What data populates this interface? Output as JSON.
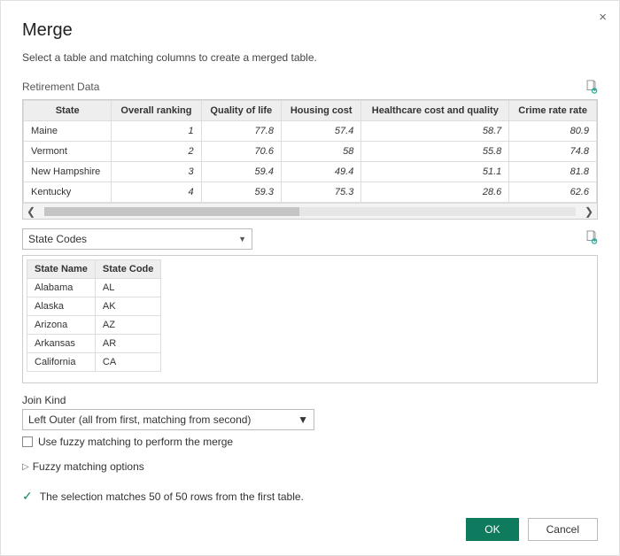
{
  "dialog": {
    "title": "Merge",
    "subtitle": "Select a table and matching columns to create a merged table.",
    "close_label": "×"
  },
  "table1": {
    "label": "Retirement Data",
    "columns": [
      "State",
      "Overall ranking",
      "Quality of life",
      "Housing cost",
      "Healthcare cost and quality",
      "Crime rate rate"
    ],
    "rows": [
      {
        "state": "Maine",
        "rank": "1",
        "quality": "77.8",
        "housing": "57.4",
        "health": "58.7",
        "crime": "80.9"
      },
      {
        "state": "Vermont",
        "rank": "2",
        "quality": "70.6",
        "housing": "58",
        "health": "55.8",
        "crime": "74.8"
      },
      {
        "state": "New Hampshire",
        "rank": "3",
        "quality": "59.4",
        "housing": "49.4",
        "health": "51.1",
        "crime": "81.8"
      },
      {
        "state": "Kentucky",
        "rank": "4",
        "quality": "59.3",
        "housing": "75.3",
        "health": "28.6",
        "crime": "62.6"
      }
    ]
  },
  "table2": {
    "dropdown": "State Codes",
    "columns": [
      "State Name",
      "State Code"
    ],
    "rows": [
      {
        "name": "Alabama",
        "code": "AL"
      },
      {
        "name": "Alaska",
        "code": "AK"
      },
      {
        "name": "Arizona",
        "code": "AZ"
      },
      {
        "name": "Arkansas",
        "code": "AR"
      },
      {
        "name": "California",
        "code": "CA"
      }
    ]
  },
  "join": {
    "label": "Join Kind",
    "selected": "Left Outer (all from first, matching from second)",
    "fuzzy_label": "Use fuzzy matching to perform the merge",
    "expander": "Fuzzy matching options"
  },
  "status": {
    "message": "The selection matches 50 of 50 rows from the first table."
  },
  "buttons": {
    "ok": "OK",
    "cancel": "Cancel"
  }
}
